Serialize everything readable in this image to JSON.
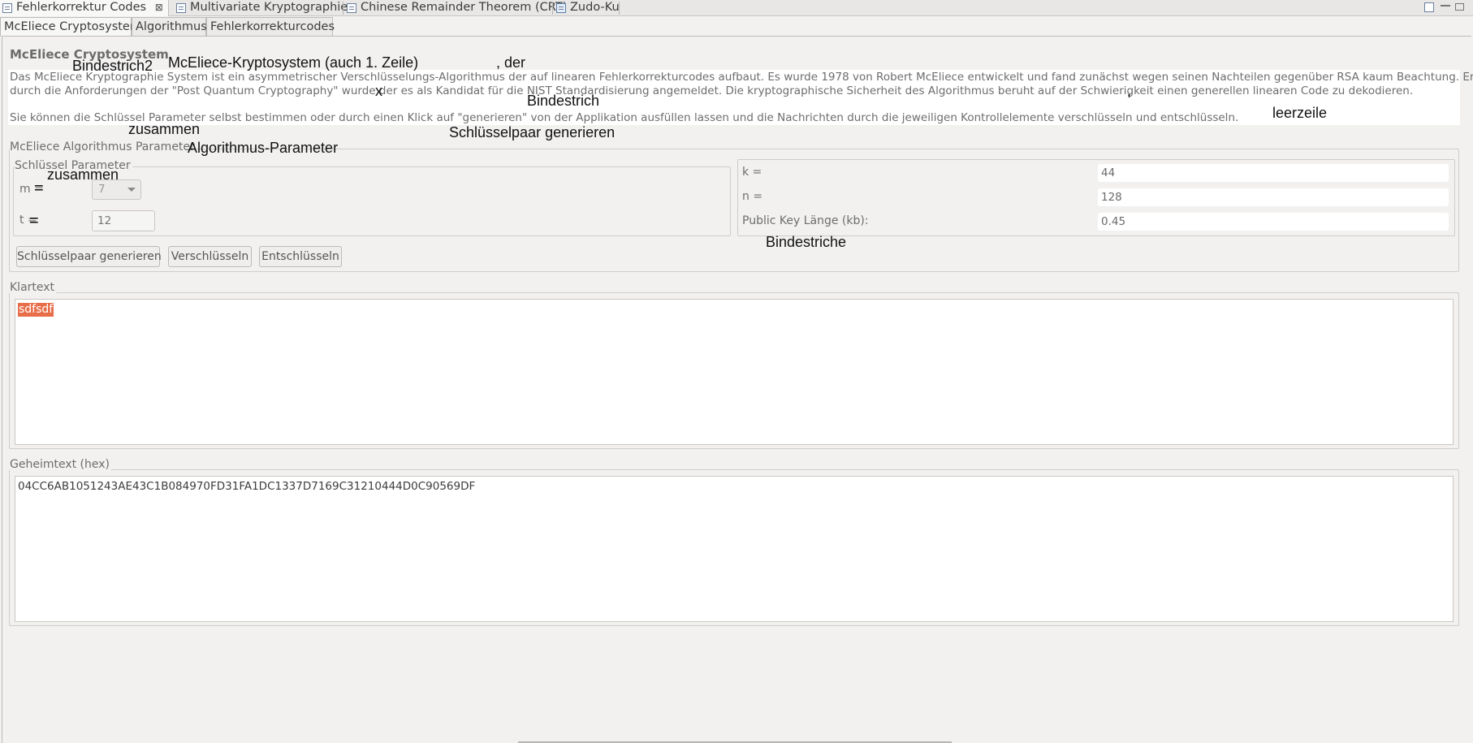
{
  "editor_tabs": [
    {
      "label": "Fehlerkorrektur Codes",
      "close": "⊠"
    },
    {
      "label": "Multivariate Kryptographie"
    },
    {
      "label": "Chinese Remainder Theorem (CRT)"
    },
    {
      "label": "Zudo-Ku"
    }
  ],
  "inner_tabs": [
    "McEliece Cryptosystem",
    "Algorithmus",
    "Fehlerkorrekturcodes"
  ],
  "section_title": "McEliece Cryptosystem",
  "description": {
    "line1": "Das McEliece Kryptographie System ist ein asymmetrischer Verschlüsselungs-Algorithmus der auf linearen Fehlerkorrekturcodes aufbaut. Es wurde 1978 von Robert McEliece entwickelt und fand zunächst wegen seinen Nachteilen gegenüber RSA kaum Beachtung. Erst",
    "line2": "durch die Anforderungen der \"Post Quantum Cryptography\" wurde der es als Kandidat für die NIST Standardisierung angemeldet. Die kryptographische Sicherheit des Algorithmus beruht auf der Schwierigkeit einen generellen linearen Code zu dekodieren.",
    "line3": "Sie können die Schlüssel Parameter selbst bestimmen oder durch einen Klick auf \"generieren\" von der Applikation ausfüllen lassen und die Nachrichten durch die jeweiligen Kontrollelemente verschlüsseln und entschlüsseln."
  },
  "params": {
    "group_title": "McEliece Algorithmus Parameter",
    "key_group_title": "Schlüssel Parameter",
    "m_label": "m =",
    "m_value": "7",
    "t_label": "t =",
    "t_value": "12",
    "k_label": "k =",
    "k_value": "44",
    "n_label": "n =",
    "n_value": "128",
    "pk_label": "Public Key Länge (kb):",
    "pk_value": "0.45"
  },
  "buttons": {
    "generate": "Schlüsselpaar generieren",
    "encrypt": "Verschlüsseln",
    "decrypt": "Entschlüsseln"
  },
  "plaintext": {
    "title": "Klartext",
    "value": "sdfsdf"
  },
  "ciphertext": {
    "title": "Geheimtext (hex)",
    "value": "04CC6AB1051243AE43C1B084970FD31FA1DC1337D7169C31210444D0C90569DF"
  },
  "annotations": {
    "bindestrich2": "Bindestrich2",
    "mceliece_kryptosystem": "McEliece-Kryptosystem (auch 1. Zeile)",
    "comma_der": ", der",
    "x_mark": "x",
    "bindestrich": "Bindestrich",
    "comma": ",",
    "leerzeile": "leerzeile",
    "zusammen1": "zusammen",
    "schluesselpaar": "Schlüsselpaar generieren",
    "algorithmus_parameter": "Algorithmus-Parameter",
    "zusammen2": "zusammen",
    "eq1": "=",
    "eq2": "=",
    "bindestriche": "Bindestriche"
  }
}
